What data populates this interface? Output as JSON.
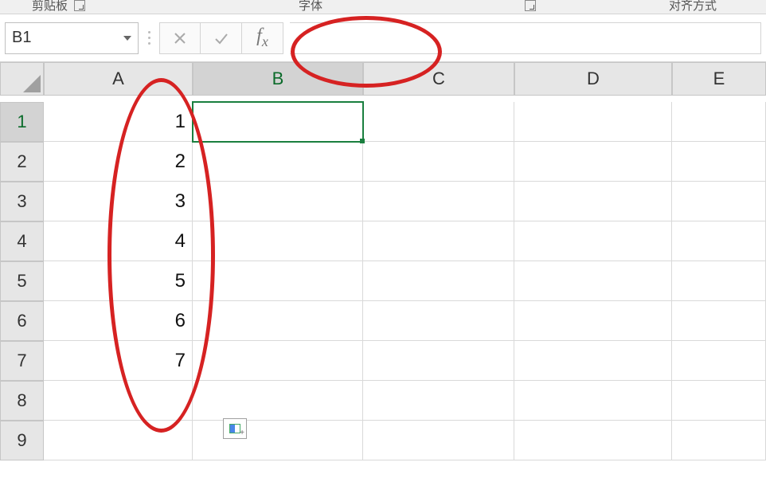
{
  "ribbon": {
    "group_clipboard": "剪贴板",
    "group_font": "字体",
    "group_alignment": "对齐方式"
  },
  "namebox": {
    "value": "B1"
  },
  "formula_bar": {
    "value": ""
  },
  "columns": [
    "A",
    "B",
    "C",
    "D",
    "E"
  ],
  "rows": [
    "1",
    "2",
    "3",
    "4",
    "5",
    "6",
    "7",
    "8",
    "9"
  ],
  "active_cell": "B1",
  "data": {
    "A": [
      "1",
      "2",
      "3",
      "4",
      "5",
      "6",
      "7",
      "",
      ""
    ]
  }
}
